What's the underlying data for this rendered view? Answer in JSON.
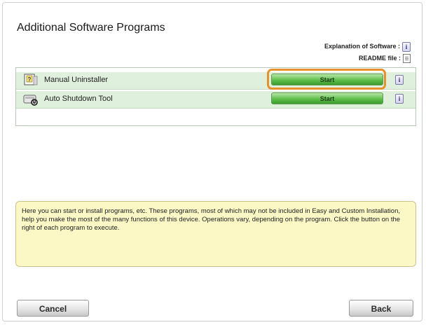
{
  "window": {
    "title": "Additional Software Programs"
  },
  "legend": {
    "explanation_label": "Explanation of Software :",
    "readme_label": "README file :"
  },
  "programs": [
    {
      "label": "Manual Uninstaller",
      "button_label": "Start",
      "icon": "uninstaller-icon",
      "highlighted": true
    },
    {
      "label": "Auto Shutdown Tool",
      "button_label": "Start",
      "icon": "shutdown-tool-icon",
      "highlighted": false
    }
  ],
  "description": "Here you can start or install programs, etc. These programs, most of which may not be included in Easy and Custom Installation, help you make the most of the many functions of this device. Operations vary, depending on the program. Click the button on the right of each program to execute.",
  "footer": {
    "cancel_label": "Cancel",
    "back_label": "Back"
  },
  "colors": {
    "highlight": "#e8902a",
    "start_button": "#5fbf4b",
    "row_background": "#dff0dc",
    "description_background": "#fbf8c6"
  }
}
